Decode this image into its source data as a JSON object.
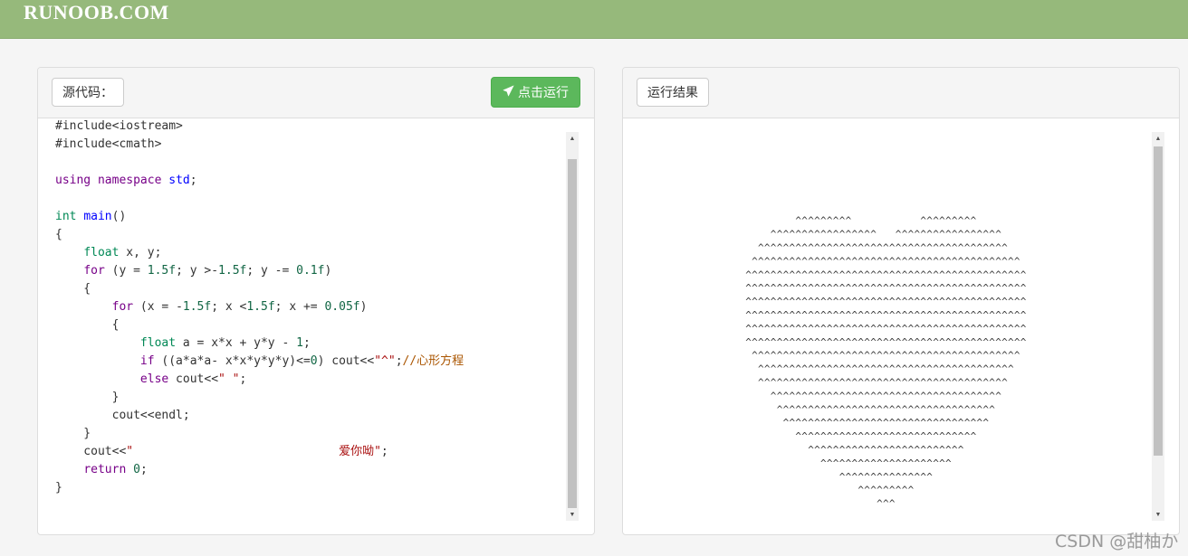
{
  "header": {
    "logo_text": "RUNOOB.COM"
  },
  "source_panel": {
    "tab_label": "源代码：",
    "run_button_label": "点击运行",
    "code_lines": [
      "#include<iostream>",
      "#include<cmath>",
      "",
      "using namespace std;",
      "",
      "int main()",
      "{",
      "    float x, y;",
      "    for (y = 1.5f; y >-1.5f; y -= 0.1f)",
      "    {",
      "        for (x = -1.5f; x <1.5f; x += 0.05f)",
      "        {",
      "            float a = x*x + y*y - 1;",
      "            if ((a*a*a- x*x*y*y*y)<=0) cout<<\"^\";//心形方程",
      "            else cout<<\" \";",
      "        }",
      "        cout<<endl;",
      "    }",
      "    cout<<\"                             爱你呦\";",
      "    return 0;",
      "}"
    ]
  },
  "result_panel": {
    "tab_label": "运行结果",
    "output_glyph": "^"
  },
  "watermark": {
    "text": "CSDN @甜柚か"
  },
  "colors": {
    "header_bg": "#96b97b",
    "run_button_bg": "#5cb85c",
    "keyword": "#770088",
    "type": "#008855",
    "number": "#116644",
    "string": "#aa1111",
    "comment": "#aa5500"
  }
}
